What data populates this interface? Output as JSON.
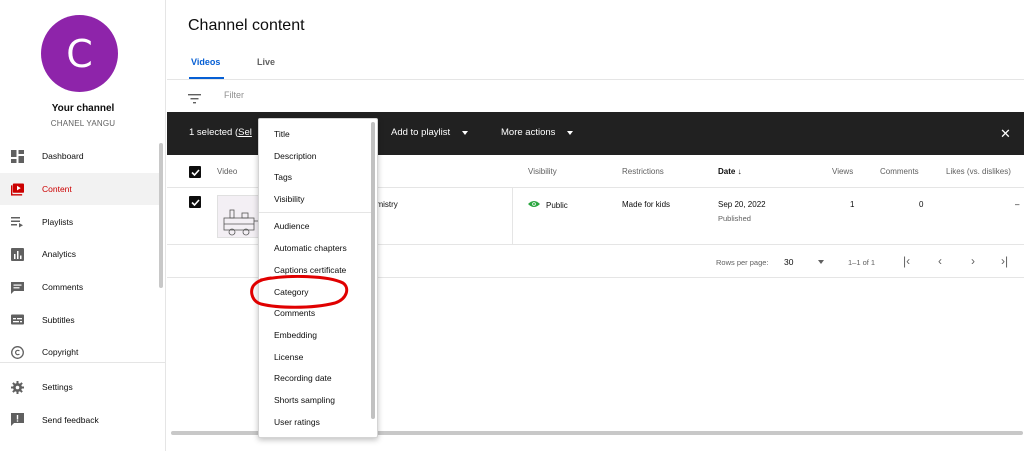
{
  "channel": {
    "avatar_letter": "C",
    "title": "Your channel",
    "name": "CHANEL YANGU",
    "avatar_color": "#8e24aa"
  },
  "sidebar": {
    "items": [
      {
        "label": "Dashboard",
        "icon": "dashboard-icon"
      },
      {
        "label": "Content",
        "icon": "video-play-icon",
        "active": true
      },
      {
        "label": "Playlists",
        "icon": "playlist-icon"
      },
      {
        "label": "Analytics",
        "icon": "bar-chart-icon"
      },
      {
        "label": "Comments",
        "icon": "comment-icon"
      },
      {
        "label": "Subtitles",
        "icon": "subtitles-icon"
      },
      {
        "label": "Copyright",
        "icon": "copyright-icon"
      },
      {
        "label": "Settings",
        "icon": "gear-icon"
      },
      {
        "label": "Send feedback",
        "icon": "feedback-icon"
      }
    ]
  },
  "page": {
    "title": "Channel content",
    "tabs": [
      {
        "label": "Videos",
        "active": true
      },
      {
        "label": "Live"
      }
    ],
    "filter_placeholder": "Filter"
  },
  "action_bar": {
    "selected_prefix": "1 selected (",
    "selected_link": "Sel",
    "add_to_playlist": "Add to playlist",
    "more_actions": "More actions"
  },
  "table": {
    "headers": {
      "video": "Video",
      "visibility": "Visibility",
      "restrictions": "Restrictions",
      "date": "Date",
      "views": "Views",
      "comments": "Comments",
      "likes": "Likes (vs. dislikes)"
    },
    "rows": [
      {
        "title_fragment": "emistry",
        "visibility": "Public",
        "restrictions": "Made for kids",
        "date": "Sep 20, 2022",
        "date_status": "Published",
        "views": "1",
        "comments": "0",
        "likes": "–"
      }
    ]
  },
  "pager": {
    "rows_per_page_label": "Rows per page:",
    "rows_per_page": "30",
    "range": "1–1 of 1"
  },
  "menu": {
    "items": [
      "Title",
      "Description",
      "Tags",
      "Visibility",
      "Audience",
      "Automatic chapters",
      "Captions certificate",
      "Category",
      "Comments",
      "Embedding",
      "License",
      "Recording date",
      "Shorts sampling",
      "User ratings"
    ]
  },
  "colors": {
    "accent": "#065fd4",
    "active_nav": "#cc0000",
    "public_icon": "#2ba640",
    "action_bar": "#212121",
    "annotation": "#e00000"
  }
}
